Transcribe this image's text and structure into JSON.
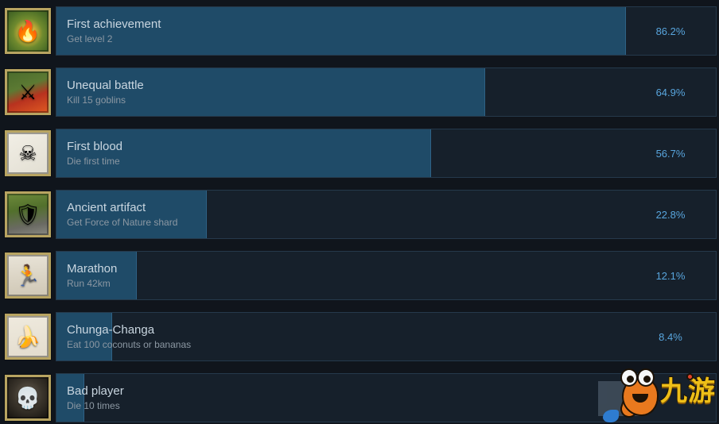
{
  "page": {
    "background_color": "#10151c",
    "bar_track_color": "#16202b",
    "bar_fill_color": "#1f4b68",
    "accent_color": "#58a5dd",
    "title_color": "#c9d6e0",
    "description_color": "#8c98a3"
  },
  "achievements": [
    {
      "title": "First achievement",
      "description": "Get level 2",
      "percent_label": "86.2%",
      "percent_value": 86.2,
      "icon_name": "campfire-icon",
      "icon_glyph": "🔥",
      "icon_class": "art-campfire"
    },
    {
      "title": "Unequal battle",
      "description": "Kill 15 goblins",
      "percent_label": "64.9%",
      "percent_value": 64.9,
      "icon_name": "sword-battle-icon",
      "icon_glyph": "⚔",
      "icon_class": "art-battle"
    },
    {
      "title": "First blood",
      "description": "Die first time",
      "percent_label": "56.7%",
      "percent_value": 56.7,
      "icon_name": "crossed-bones-icon",
      "icon_glyph": "☠",
      "icon_class": "art-bones"
    },
    {
      "title": "Ancient artifact",
      "description": "Get Force of Nature shard",
      "percent_label": "22.8%",
      "percent_value": 22.8,
      "icon_name": "ancient-artifact-icon",
      "icon_glyph": "🛡",
      "icon_class": "art-artifact"
    },
    {
      "title": "Marathon",
      "description": "Run 42km",
      "percent_label": "12.1%",
      "percent_value": 12.1,
      "icon_name": "runner-icon",
      "icon_glyph": "🏃",
      "icon_class": "art-marathon"
    },
    {
      "title": "Chunga-Changa",
      "description": "Eat 100 coconuts or bananas",
      "percent_label": "8.4%",
      "percent_value": 8.4,
      "icon_name": "banana-coconut-icon",
      "icon_glyph": "🍌",
      "icon_class": "art-fruit"
    },
    {
      "title": "Bad player",
      "description": "Die 10 times",
      "percent_label": "",
      "percent_value": 4.2,
      "icon_name": "grim-reaper-icon",
      "icon_glyph": "💀",
      "icon_class": "art-reaper"
    }
  ],
  "watermark": {
    "text": "九游",
    "name": "jiuyou-watermark"
  }
}
